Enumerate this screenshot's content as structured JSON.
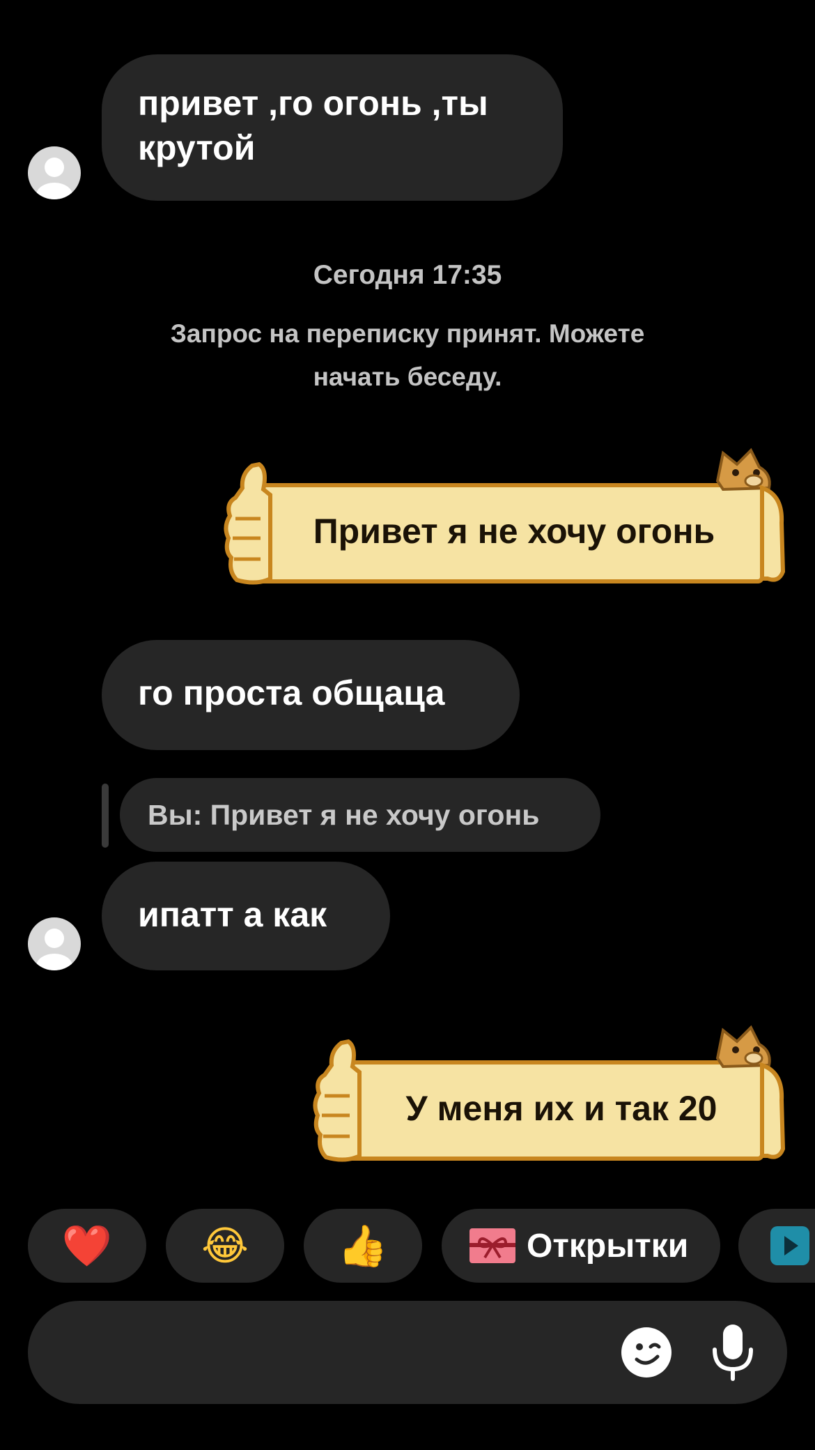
{
  "messages": {
    "m1": "привет ,го огонь ,ты крутой",
    "m2": "го проста общаца",
    "m3": "ипатт а как"
  },
  "system": {
    "timestamp": "Сегодня 17:35",
    "notice_line1": "Запрос на переписку принят. Можете",
    "notice_line2": "начать беседу."
  },
  "stickers": {
    "s1": "Привет я не хочу огонь",
    "s2": "У меня их и так 20"
  },
  "reply": {
    "quote": "Вы: Привет я не хочу огонь"
  },
  "quick_replies": {
    "heart": "❤️",
    "laugh": "😂",
    "thumbs": "👍",
    "postcards_label": "Открытки"
  },
  "icons": {
    "avatar": "default-avatar-icon",
    "sticker_icon": "gift-ribbon-icon",
    "partial_chip_icon": "play-icon",
    "emoji_button": "smiley-wink-icon",
    "mic_button": "microphone-icon"
  },
  "colors": {
    "background": "#000000",
    "bubble": "#262626",
    "sticker_paper": "#f6e3a3",
    "sticker_outline": "#c8861f",
    "gift_icon": "#f17c8d",
    "play_chip": "#1f8ea8"
  }
}
